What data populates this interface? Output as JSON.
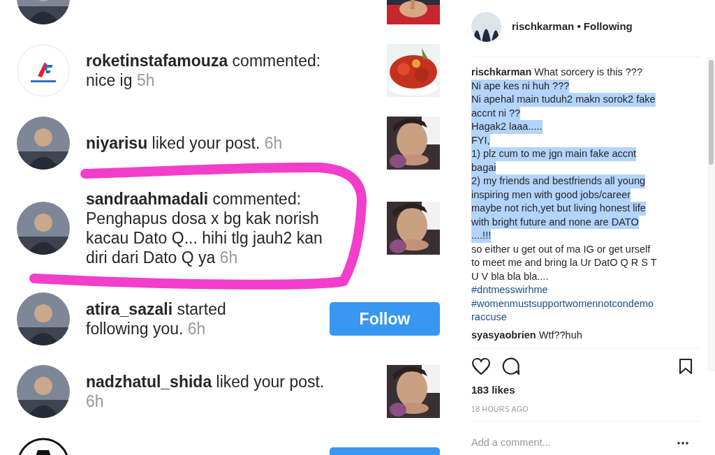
{
  "notifications": [
    {
      "action": {
        "kind": "thumbnail"
      }
    },
    {
      "user": "roketinstafamouza",
      "message": "commented: nice ig",
      "time": "5h",
      "avatar": {
        "kind": "logo"
      },
      "action": {
        "kind": "thumbnail"
      }
    },
    {
      "user": "niyarisu",
      "message": "liked your post.",
      "time": "6h",
      "action": {
        "kind": "thumbnail"
      }
    },
    {
      "user": "sandraahmadali",
      "message": "commented: Penghapus dosa x bg kak norish kacau Dato Q... hihi tlg jauh2 kan diri dari Dato Q ya",
      "time": "6h",
      "action": {
        "kind": "thumbnail"
      },
      "annotation": {
        "kind": "freehand-loop"
      }
    },
    {
      "user": "atira_sazali",
      "message": "started following you.",
      "time": "6h",
      "action": {
        "kind": "button",
        "label": "Follow"
      }
    },
    {
      "user": "nadzhatul_shida",
      "message": "liked your post.",
      "time": "6h",
      "action": {
        "kind": "thumbnail"
      }
    },
    {
      "avatar": {
        "kind": "hat"
      },
      "action": {
        "kind": "button"
      }
    }
  ],
  "post": {
    "header": {
      "user": "rischkarman",
      "separator": "•",
      "status": "Following"
    },
    "caption": {
      "user": "rischkarman",
      "lines": [
        {
          "text": "What sorcery is this ???",
          "kind": "text",
          "selected": false
        },
        {
          "text": "Ni ape kes ni huh ???",
          "kind": "text",
          "selected": true
        },
        {
          "text": "Ni apehal main tuduh2 makn sorok2 fake",
          "kind": "text",
          "selected": true
        },
        {
          "text": "accnt ni ??",
          "kind": "text",
          "selected": true
        },
        {
          "text": "Hagak2 laaa.....",
          "kind": "text",
          "selected": true
        },
        {
          "text": "FYI,",
          "kind": "text",
          "selected": true
        },
        {
          "text": "1) plz cum to me jgn main fake accnt",
          "kind": "text",
          "selected": true
        },
        {
          "text": "bagai",
          "kind": "text",
          "selected": true
        },
        {
          "text": "2) my friends and bestfriends all young",
          "kind": "text",
          "selected": true
        },
        {
          "text": "inspiring men with good jobs/career",
          "kind": "text",
          "selected": true
        },
        {
          "text": "maybe not rich,yet but living honest life",
          "kind": "text",
          "selected": true
        },
        {
          "text": "with bright future and none are DATO",
          "kind": "text",
          "selected": true
        },
        {
          "text": "....!!!",
          "kind": "text",
          "selected": true
        },
        {
          "text": "so either u get out of ma IG or get urself",
          "kind": "text",
          "selected": false
        },
        {
          "text": "to meet me and bring la Ur DatO Q R S T",
          "kind": "text",
          "selected": false
        },
        {
          "text": "U V bla bla bla....",
          "kind": "text",
          "selected": false
        },
        {
          "text": "#dntmesswirhme",
          "kind": "hashtag",
          "selected": false
        },
        {
          "text": "#womenmustsupportwomennotcondemo",
          "kind": "hashtag",
          "selected": false
        },
        {
          "text": "raccuse",
          "kind": "hashtag",
          "selected": false
        }
      ]
    },
    "comments": [
      {
        "user": "syasyaobrien",
        "text": "Wtf??huh"
      }
    ],
    "likes": "183 likes",
    "time": "18 HOURS AGO",
    "comment_placeholder": "Add a comment..."
  }
}
